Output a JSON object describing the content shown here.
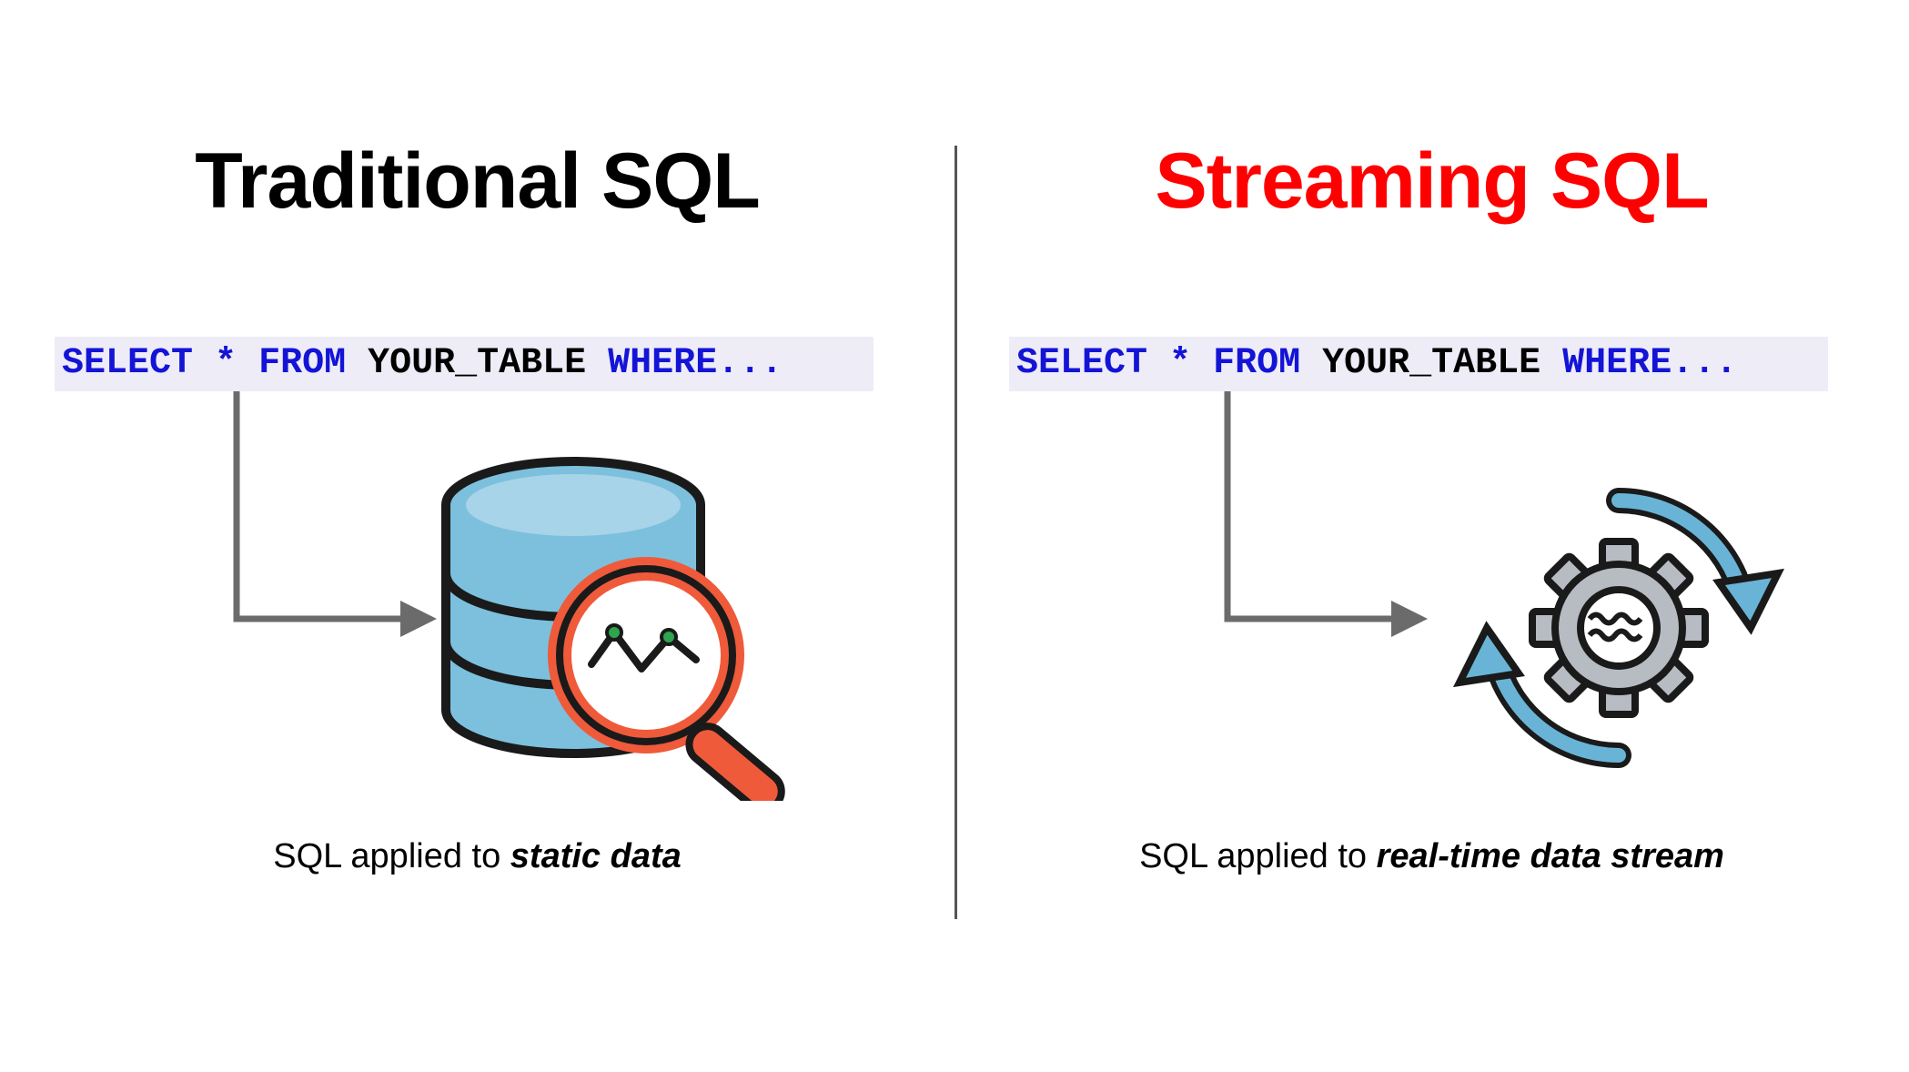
{
  "left": {
    "title": "Traditional SQL",
    "sql": {
      "k1": "SELECT",
      "star": "*",
      "k2": "FROM",
      "tbl": "YOUR_TABLE",
      "k3": "WHERE..."
    },
    "caption_prefix": "SQL applied to ",
    "caption_em": "static data"
  },
  "right": {
    "title": "Streaming SQL",
    "sql": {
      "k1": "SELECT",
      "star": "*",
      "k2": "FROM",
      "tbl": "YOUR_TABLE",
      "k3": "WHERE..."
    },
    "caption_prefix": "SQL applied to ",
    "caption_em": "real-time data stream"
  },
  "colors": {
    "title_left": "#000000",
    "title_right": "#ff0000",
    "sql_keyword": "#1414d6",
    "sql_bg": "#eeecf7",
    "arrow": "#6b6b6b",
    "db_fill": "#7cc0dd",
    "db_stroke": "#1a1a1a",
    "magnifier": "#ef5a3a",
    "gear": "#9aa1a8",
    "cycle": "#69b4d6"
  }
}
